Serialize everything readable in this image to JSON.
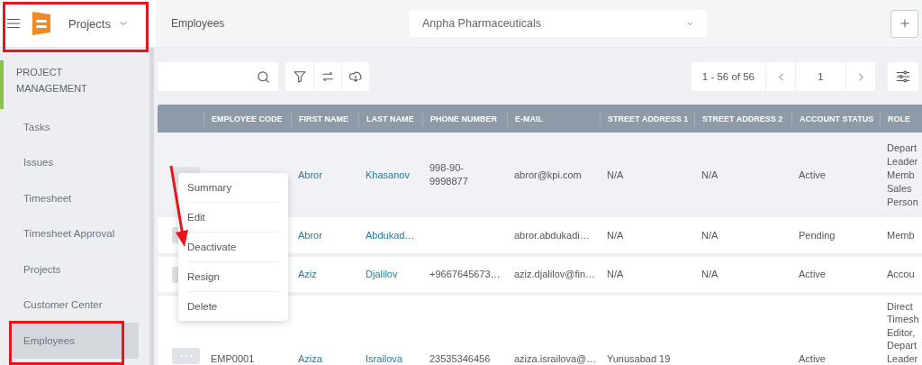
{
  "top_bar": {
    "module_select": "Projects",
    "breadcrumb": "Employees",
    "company_select": "Anpha Pharmaceuticals"
  },
  "sidebar": {
    "section": {
      "title": "PROJECT MANAGEMENT",
      "expanded": true
    },
    "items": [
      {
        "label": "Tasks",
        "selected": false
      },
      {
        "label": "Issues",
        "selected": false
      },
      {
        "label": "Timesheet",
        "selected": false
      },
      {
        "label": "Timesheet Approval",
        "selected": false
      },
      {
        "label": "Projects",
        "selected": false
      },
      {
        "label": "Customer Center",
        "selected": false
      },
      {
        "label": "Employees",
        "selected": true
      }
    ]
  },
  "pagination": {
    "range": "1 - 56 of 56",
    "page": "1"
  },
  "table": {
    "columns": [
      "EMPLOYEE CODE",
      "FIRST NAME",
      "LAST NAME",
      "PHONE NUMBER",
      "E-MAIL",
      "STREET ADDRESS 1",
      "STREET ADDRESS 2",
      "ACCOUNT STATUS",
      "ROLE"
    ],
    "rows": [
      {
        "highlighted": true,
        "cells": {
          "first_name": "Abror",
          "last_name": "Khasanov",
          "phone_number": "998-90-9998877",
          "email": "abror@kpi.com",
          "street_address_1": "N/A",
          "street_address_2": "N/A",
          "account_status": "Active",
          "role": "Depart Leader Memb Sales Person"
        }
      },
      {
        "highlighted": false,
        "cells": {
          "first_name": "Abror",
          "last_name": "Abdukad…",
          "email": "abror.abdukadi…",
          "street_address_1": "N/A",
          "street_address_2": "N/A",
          "account_status": "Pending",
          "role": "Memb"
        }
      },
      {
        "highlighted": false,
        "cells": {
          "first_name": "Aziz",
          "last_name": "Djalilov",
          "phone_number": "+9667645673…",
          "email": "aziz.djalilov@fin…",
          "street_address_1": "N/A",
          "street_address_2": "N/A",
          "account_status": "Active",
          "role": "Accou"
        }
      },
      {
        "highlighted": false,
        "cells": {
          "employee_code": "EMP0001",
          "first_name": "Aziza",
          "last_name": "Israilova",
          "phone_number": "23535346456",
          "email": "aziza.israilova@…",
          "street_address_1": "Yunusabad 19",
          "account_status": "Active",
          "role": "Direct Timesh Editor, Depart Leader"
        }
      }
    ]
  },
  "context_menu": {
    "items": [
      "Summary",
      "Edit",
      "Deactivate",
      "Resign",
      "Delete"
    ]
  }
}
